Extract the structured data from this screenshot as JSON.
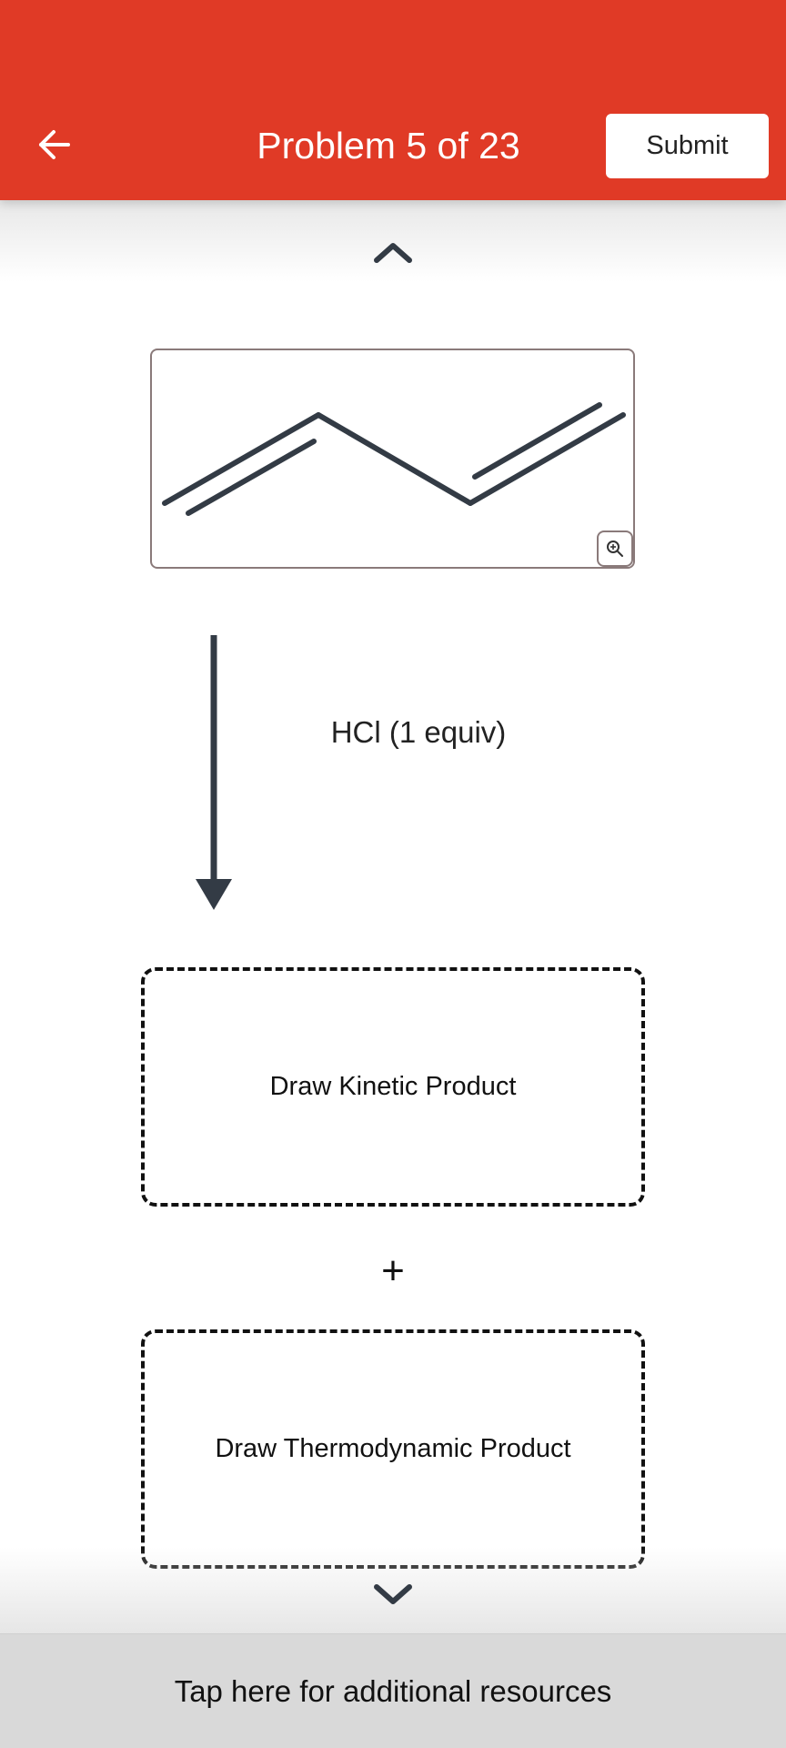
{
  "header": {
    "title": "Problem 5 of 23",
    "submit_label": "Submit",
    "back_icon": "arrow-left-icon",
    "background_color": "#e03a26"
  },
  "problem": {
    "reagent": "HCl (1 equiv)",
    "starting_material": "1,3-butadiene skeletal structure",
    "zoom_icon": "zoom-in-icon"
  },
  "answers": {
    "kinetic_label": "Draw Kinetic Product",
    "plus": "+",
    "thermodynamic_label": "Draw Thermodynamic Product"
  },
  "footer": {
    "resources_label": "Tap here for additional resources"
  }
}
